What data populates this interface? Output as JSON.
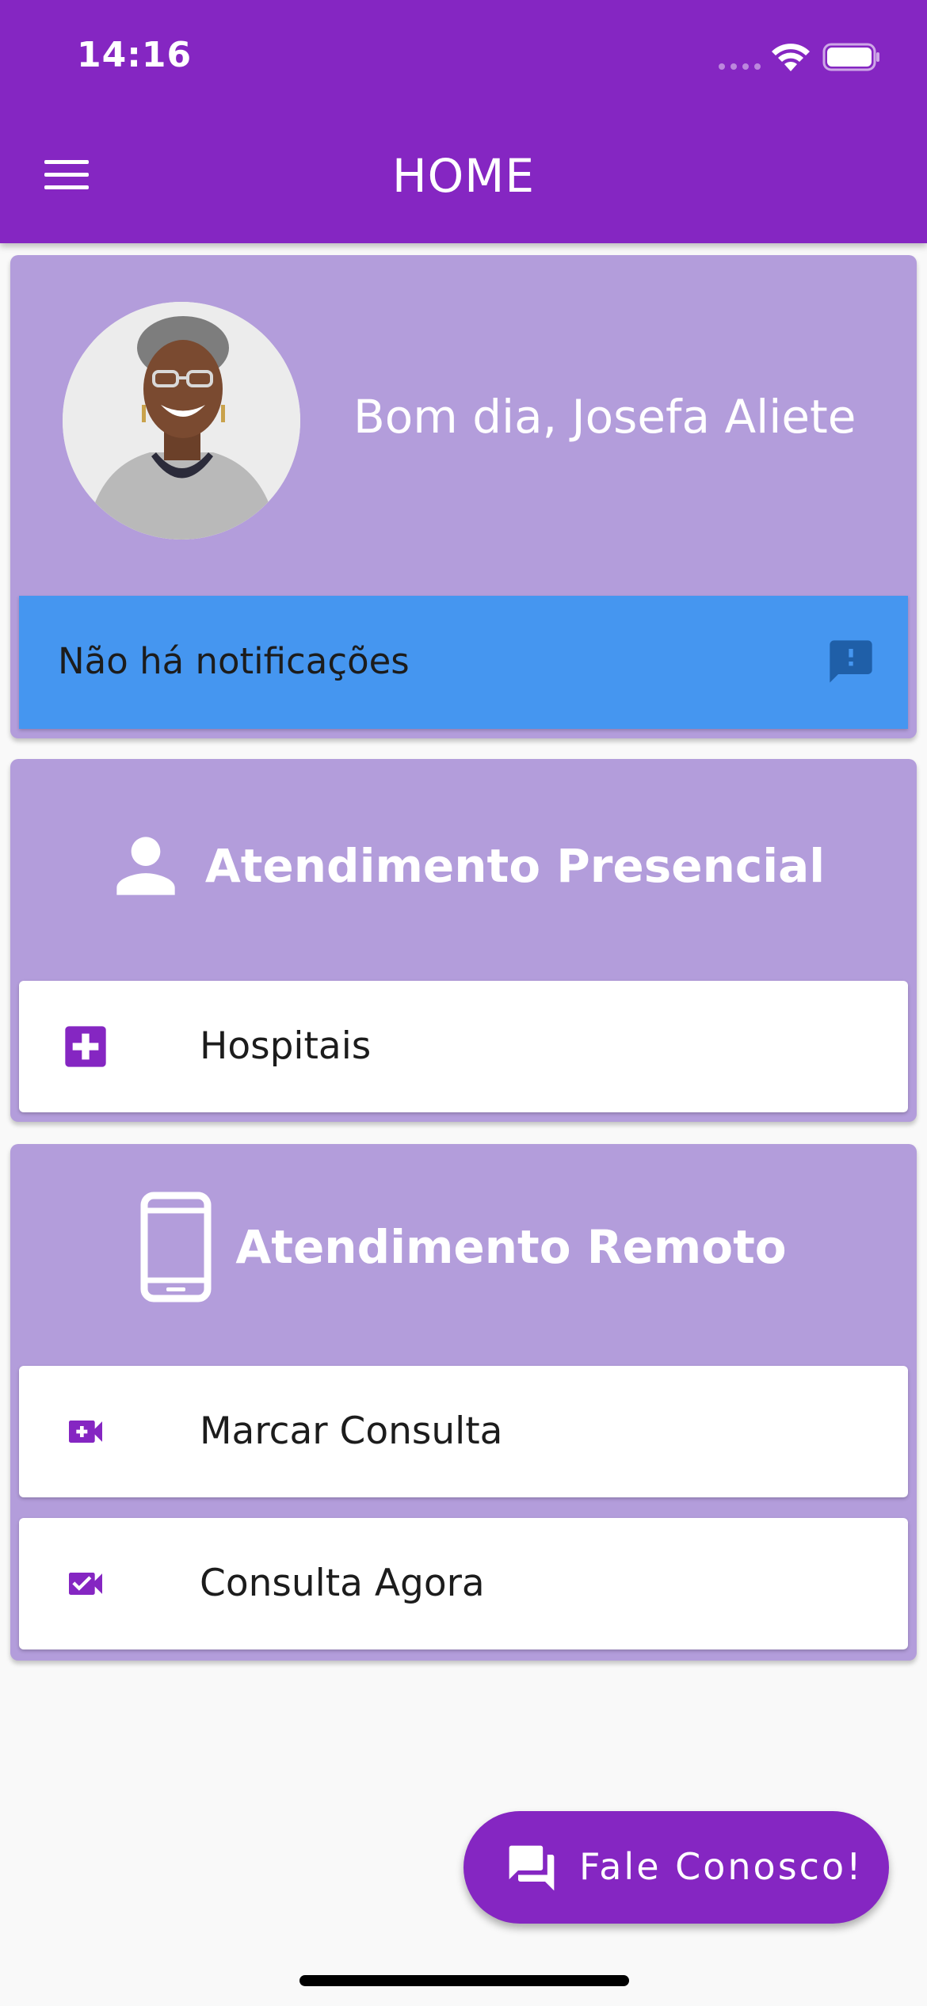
{
  "status_bar": {
    "time": "14:16"
  },
  "app_bar": {
    "title": "HOME",
    "menu_icon": "hamburger-menu-icon"
  },
  "greeting_card": {
    "greeting": "Bom dia, Josefa Aliete",
    "avatar": "user-profile-photo",
    "notification": {
      "text": "Não há notificações",
      "icon": "feedback-alert-icon"
    }
  },
  "presencial_card": {
    "title": "Atendimento Presencial",
    "icon": "person-icon",
    "items": [
      {
        "label": "Hospitais",
        "icon": "hospital-plus-icon"
      }
    ]
  },
  "remoto_card": {
    "title": "Atendimento Remoto",
    "icon": "smartphone-icon",
    "items": [
      {
        "label": "Marcar Consulta",
        "icon": "video-call-add-icon"
      },
      {
        "label": "Consulta Agora",
        "icon": "video-call-check-icon"
      }
    ]
  },
  "fab": {
    "label": "Fale Conosco!",
    "icon": "chat-bubbles-icon"
  },
  "colors": {
    "primary": "#8526c2",
    "card_background": "#b39ddb",
    "notification_background": "#4596f0",
    "notification_icon": "#1f5fa8",
    "page_background": "#f9f9f9"
  }
}
